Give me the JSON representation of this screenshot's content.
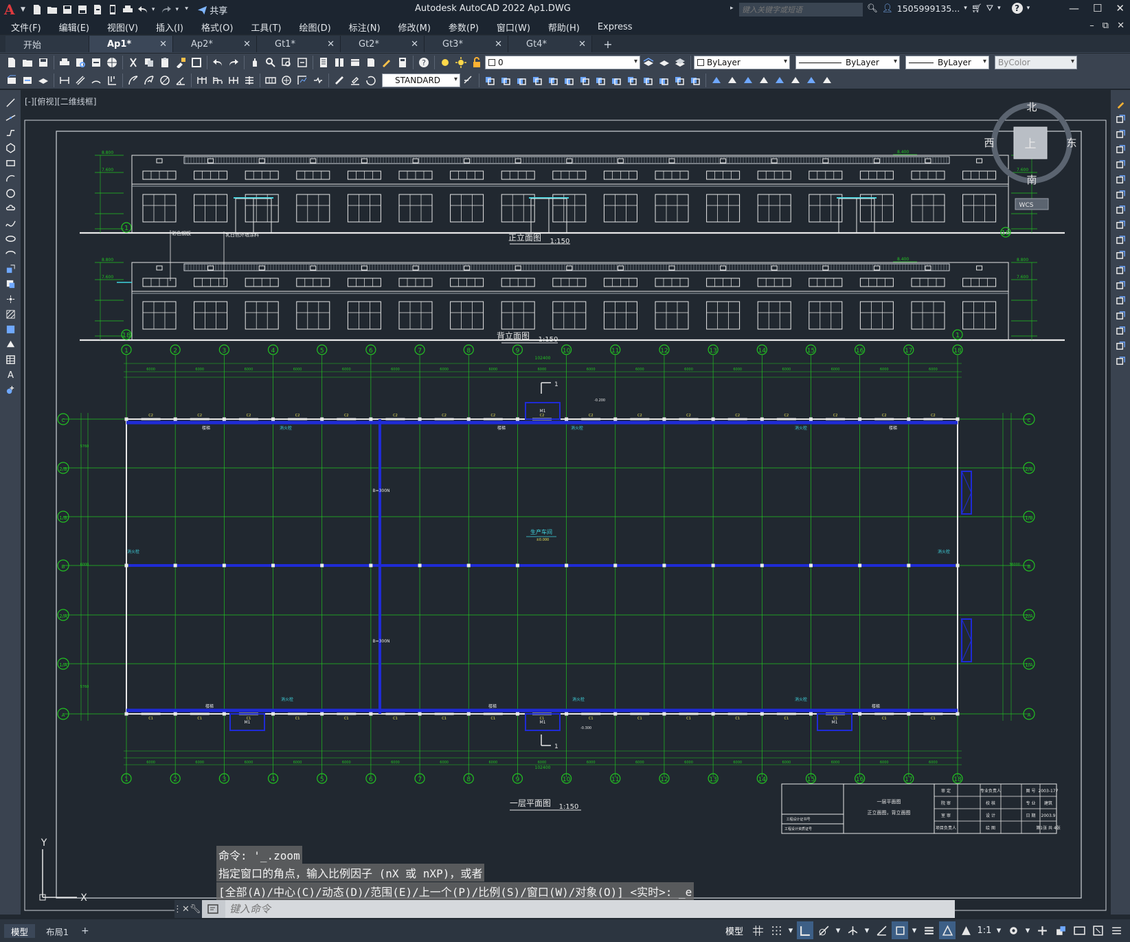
{
  "app": {
    "title": "Autodesk AutoCAD 2022    Ap1.DWG",
    "logo": "A",
    "share_label": "共享",
    "search_placeholder": "键入关键字或短语",
    "user": "1505999135...",
    "help": "?"
  },
  "menu": [
    "文件(F)",
    "编辑(E)",
    "视图(V)",
    "插入(I)",
    "格式(O)",
    "工具(T)",
    "绘图(D)",
    "标注(N)",
    "修改(M)",
    "参数(P)",
    "窗口(W)",
    "帮助(H)",
    "Express"
  ],
  "tabs": [
    {
      "label": "开始",
      "closable": false,
      "active": false
    },
    {
      "label": "Ap1*",
      "closable": true,
      "active": true
    },
    {
      "label": "Ap2*",
      "closable": true,
      "active": false
    },
    {
      "label": "Gt1*",
      "closable": true,
      "active": false
    },
    {
      "label": "Gt2*",
      "closable": true,
      "active": false
    },
    {
      "label": "Gt3*",
      "closable": true,
      "active": false
    },
    {
      "label": "Gt4*",
      "closable": true,
      "active": false
    }
  ],
  "toolbar": {
    "layer_value": "0",
    "color_value": "ByLayer",
    "linetype_value": "ByLayer",
    "lineweight_value": "ByLayer",
    "plotstyle_value": "ByColor",
    "textstyle_value": "STANDARD"
  },
  "viewport": {
    "label": "[-][俯视][二维线框]",
    "viewcube": {
      "north": "北",
      "south": "南",
      "east": "东",
      "west": "西",
      "top": "上",
      "wcs": "WCS"
    },
    "ucs": {
      "x": "X",
      "y": "Y"
    }
  },
  "drawing": {
    "front_elevation_title": "正立面图",
    "back_elevation_title": "背立面图",
    "plan_title": "一层平面图",
    "scale": "1:150",
    "room_label": "生产车间",
    "room_elev": "±0.000",
    "section_mark": "1",
    "annot_note_1": "彩色钢板",
    "annot_note_2": "乳白色外墙涂料",
    "plan_elev_1": "-0.200",
    "plan_elev_2": "-0.300",
    "top_elev": "8.800",
    "mid_elev_left": "7.600",
    "elev_tag_1": "8.400",
    "column_axes": [
      "1",
      "2",
      "3",
      "4",
      "5",
      "6",
      "7",
      "8",
      "9",
      "10",
      "11",
      "12",
      "13",
      "14",
      "15",
      "16",
      "17",
      "18"
    ],
    "row_axes": [
      "C",
      "2/B",
      "1/B",
      "B",
      "2/A",
      "1/A",
      "A"
    ],
    "elev_axis_left": "1",
    "elev_axis_right": "18",
    "back_axis_left": "18",
    "back_axis_right": "1",
    "total_dim": "102400",
    "bay_dim": "6000",
    "window_tag": "C2",
    "window_tag_alt": "C1",
    "door_tag": "M1",
    "fire_label": "消火栓",
    "stair_label": "楼梯",
    "row_dims": [
      "5760",
      "6000",
      "5760"
    ],
    "overall_depth": "36000",
    "beam_label_1": "B=300N",
    "beam_label_2": "B=300N"
  },
  "titleblock": {
    "drawing_name_1": "一层平面图",
    "drawing_name_2": "正立面图，背立面图",
    "rows": [
      [
        "审 定",
        "",
        "专业负责人",
        "",
        "图 号",
        "2003-177"
      ],
      [
        "院 审",
        "",
        "校 核",
        "",
        "专 业",
        "建筑"
      ],
      [
        "室 审",
        "",
        "设 计",
        "",
        "日 期",
        "2003.9"
      ],
      [
        "项目负责人",
        "",
        "绘 图",
        "",
        "",
        "第1张 共 4张"
      ]
    ],
    "left_cells": [
      "工程设计证书号",
      "工程设计资质证号"
    ]
  },
  "command": {
    "history": [
      "命令: '_.zoom",
      "指定窗口的角点，输入比例因子 (nX 或 nXP)，或者",
      "[全部(A)/中心(C)/动态(D)/范围(E)/上一个(P)/比例(S)/窗口(W)/对象(O)] <实时>: _e"
    ],
    "placeholder": "键入命令"
  },
  "layout_tabs": [
    "模型",
    "布局1"
  ],
  "status": {
    "model_label": "模型",
    "scale": "1:1"
  },
  "colors": {
    "bg": "#212830",
    "green": "#22c322",
    "white": "#e8e8e8",
    "blue": "#1f2bd6",
    "cyan": "#3fd6e0",
    "yellow": "#e8e05a"
  }
}
